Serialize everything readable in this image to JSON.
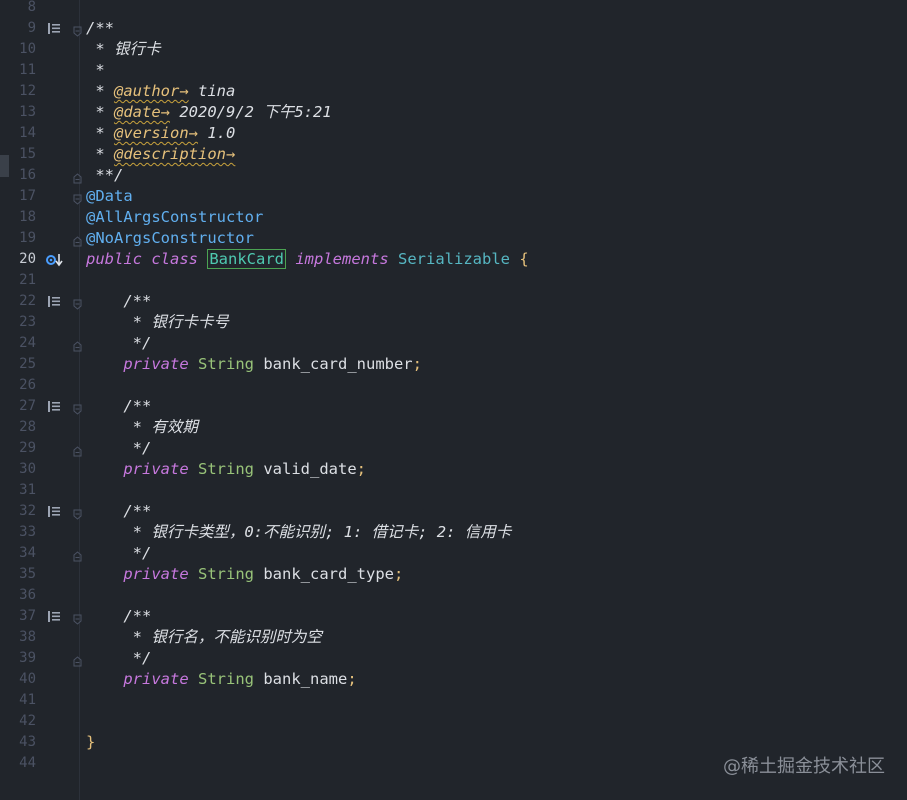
{
  "editor": {
    "lines": [
      {
        "n": "8",
        "tokens": []
      },
      {
        "n": "9",
        "tokens": [
          {
            "t": "/**",
            "c": "c-com"
          }
        ],
        "marker": "doc",
        "fold": "open"
      },
      {
        "n": "10",
        "tokens": [
          {
            "t": " * 银行卡",
            "c": "c-com"
          }
        ]
      },
      {
        "n": "11",
        "tokens": [
          {
            "t": " *",
            "c": "c-com"
          }
        ]
      },
      {
        "n": "12",
        "tokens": [
          {
            "t": " * ",
            "c": "c-com"
          },
          {
            "t": "@author→",
            "c": "c-tag"
          },
          {
            "t": " tina",
            "c": "c-com"
          }
        ]
      },
      {
        "n": "13",
        "tokens": [
          {
            "t": " * ",
            "c": "c-com"
          },
          {
            "t": "@date→",
            "c": "c-tag"
          },
          {
            "t": " 2020/9/2 下午5:21",
            "c": "c-com"
          }
        ]
      },
      {
        "n": "14",
        "tokens": [
          {
            "t": " * ",
            "c": "c-com"
          },
          {
            "t": "@version→",
            "c": "c-tag"
          },
          {
            "t": " 1.0",
            "c": "c-com"
          }
        ]
      },
      {
        "n": "15",
        "tokens": [
          {
            "t": " * ",
            "c": "c-com"
          },
          {
            "t": "@description→",
            "c": "c-tag"
          }
        ]
      },
      {
        "n": "16",
        "tokens": [
          {
            "t": " **/",
            "c": "c-com"
          }
        ],
        "fold": "close"
      },
      {
        "n": "17",
        "tokens": [
          {
            "t": "@Data",
            "c": "c-ann"
          }
        ],
        "fold": "open"
      },
      {
        "n": "18",
        "tokens": [
          {
            "t": "@AllArgsConstructor",
            "c": "c-ann"
          }
        ]
      },
      {
        "n": "19",
        "tokens": [
          {
            "t": "@NoArgsConstructor",
            "c": "c-ann"
          }
        ],
        "fold": "close"
      },
      {
        "n": "20",
        "tokens": [
          {
            "t": "public class ",
            "c": "c-kw"
          },
          {
            "t": "BankCard",
            "c": "c-cls"
          },
          {
            "t": " "
          },
          {
            "t": "implements",
            "c": "c-kw"
          },
          {
            "t": " "
          },
          {
            "t": "Serializable",
            "c": "c-iface"
          },
          {
            "t": " {",
            "c": "c-punc"
          }
        ],
        "marker": "impl",
        "active": true
      },
      {
        "n": "21",
        "tokens": []
      },
      {
        "n": "22",
        "tokens": [
          {
            "t": "    /**",
            "c": "c-com"
          }
        ],
        "marker": "doc",
        "fold": "open"
      },
      {
        "n": "23",
        "tokens": [
          {
            "t": "     * 银行卡卡号",
            "c": "c-com"
          }
        ]
      },
      {
        "n": "24",
        "tokens": [
          {
            "t": "     */",
            "c": "c-com"
          }
        ],
        "fold": "close"
      },
      {
        "n": "25",
        "tokens": [
          {
            "t": "    "
          },
          {
            "t": "private",
            "c": "c-kw"
          },
          {
            "t": " "
          },
          {
            "t": "String",
            "c": "c-type"
          },
          {
            "t": " bank_card_number",
            "c": "c-field"
          },
          {
            "t": ";",
            "c": "c-punc"
          }
        ]
      },
      {
        "n": "26",
        "tokens": []
      },
      {
        "n": "27",
        "tokens": [
          {
            "t": "    /**",
            "c": "c-com"
          }
        ],
        "marker": "doc",
        "fold": "open"
      },
      {
        "n": "28",
        "tokens": [
          {
            "t": "     * 有效期",
            "c": "c-com"
          }
        ]
      },
      {
        "n": "29",
        "tokens": [
          {
            "t": "     */",
            "c": "c-com"
          }
        ],
        "fold": "close"
      },
      {
        "n": "30",
        "tokens": [
          {
            "t": "    "
          },
          {
            "t": "private",
            "c": "c-kw"
          },
          {
            "t": " "
          },
          {
            "t": "String",
            "c": "c-type"
          },
          {
            "t": " valid_date",
            "c": "c-field"
          },
          {
            "t": ";",
            "c": "c-punc"
          }
        ]
      },
      {
        "n": "31",
        "tokens": []
      },
      {
        "n": "32",
        "tokens": [
          {
            "t": "    /**",
            "c": "c-com"
          }
        ],
        "marker": "doc",
        "fold": "open"
      },
      {
        "n": "33",
        "tokens": [
          {
            "t": "     * 银行卡类型，0:不能识别; 1: 借记卡; 2: 信用卡",
            "c": "c-com"
          }
        ]
      },
      {
        "n": "34",
        "tokens": [
          {
            "t": "     */",
            "c": "c-com"
          }
        ],
        "fold": "close"
      },
      {
        "n": "35",
        "tokens": [
          {
            "t": "    "
          },
          {
            "t": "private",
            "c": "c-kw"
          },
          {
            "t": " "
          },
          {
            "t": "String",
            "c": "c-type"
          },
          {
            "t": " bank_card_type",
            "c": "c-field"
          },
          {
            "t": ";",
            "c": "c-punc"
          }
        ]
      },
      {
        "n": "36",
        "tokens": []
      },
      {
        "n": "37",
        "tokens": [
          {
            "t": "    /**",
            "c": "c-com"
          }
        ],
        "marker": "doc",
        "fold": "open"
      },
      {
        "n": "38",
        "tokens": [
          {
            "t": "     * 银行名，不能识别时为空",
            "c": "c-com"
          }
        ]
      },
      {
        "n": "39",
        "tokens": [
          {
            "t": "     */",
            "c": "c-com"
          }
        ],
        "fold": "close"
      },
      {
        "n": "40",
        "tokens": [
          {
            "t": "    "
          },
          {
            "t": "private",
            "c": "c-kw"
          },
          {
            "t": " "
          },
          {
            "t": "String",
            "c": "c-type"
          },
          {
            "t": " bank_name",
            "c": "c-field"
          },
          {
            "t": ";",
            "c": "c-punc"
          }
        ]
      },
      {
        "n": "41",
        "tokens": []
      },
      {
        "n": "42",
        "tokens": []
      },
      {
        "n": "43",
        "tokens": [
          {
            "t": "}",
            "c": "c-punc"
          }
        ]
      },
      {
        "n": "44",
        "tokens": []
      }
    ]
  },
  "watermark": "@稀土掘金技术社区",
  "colors": {
    "background": "#21252b",
    "comment": "#dcdfe4",
    "javadoc_tag": "#e5c07b",
    "annotation": "#61afef",
    "keyword": "#c678dd",
    "type": "#98c379",
    "interface": "#56b6c2"
  }
}
